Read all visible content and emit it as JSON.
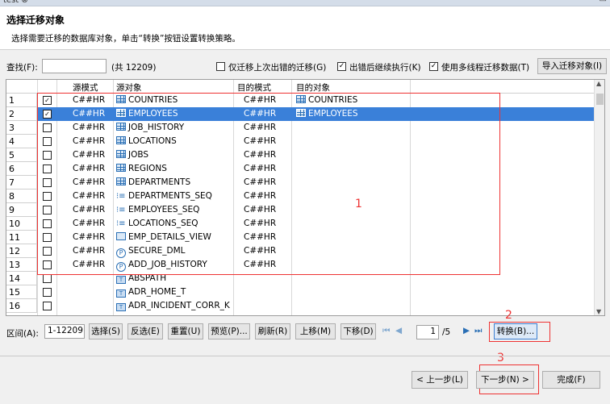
{
  "window": {
    "tab": "test",
    "tab_close": "⊗"
  },
  "header": {
    "title": "选择迁移对象",
    "description": "选择需要迁移的数据库对象，单击“转换”按钮设置转换策略。"
  },
  "find": {
    "label": "查找(F):",
    "value": "",
    "count": "(共 12209)"
  },
  "options": {
    "only_failed": "仅迁移上次出错的迁移(G)",
    "only_failed_checked": false,
    "continue_on_error": "出错后继续执行(K)",
    "continue_on_error_checked": true,
    "multithread": "使用多线程迁移数据(T)",
    "multithread_checked": true,
    "import_button": "导入迁移对象(I)"
  },
  "grid": {
    "headers": {
      "src_schema": "源模式",
      "src_object": "源对象",
      "dst_schema": "目的模式",
      "dst_object": "目的对象"
    },
    "rows": [
      {
        "n": "1",
        "checked": true,
        "src_schema": "C##HR",
        "src_object": "COUNTRIES",
        "icon": "table-icon",
        "dst_schema": "C##HR",
        "dst_object": "COUNTRIES"
      },
      {
        "n": "2",
        "checked": true,
        "src_schema": "C##HR",
        "src_object": "EMPLOYEES",
        "icon": "table-icon",
        "dst_schema": "C##HR",
        "dst_object": "EMPLOYEES",
        "selected": true
      },
      {
        "n": "3",
        "checked": false,
        "src_schema": "C##HR",
        "src_object": "JOB_HISTORY",
        "icon": "table-icon",
        "dst_schema": "C##HR",
        "dst_object": ""
      },
      {
        "n": "4",
        "checked": false,
        "src_schema": "C##HR",
        "src_object": "LOCATIONS",
        "icon": "table-icon",
        "dst_schema": "C##HR",
        "dst_object": ""
      },
      {
        "n": "5",
        "checked": false,
        "src_schema": "C##HR",
        "src_object": "JOBS",
        "icon": "table-icon",
        "dst_schema": "C##HR",
        "dst_object": ""
      },
      {
        "n": "6",
        "checked": false,
        "src_schema": "C##HR",
        "src_object": "REGIONS",
        "icon": "table-icon",
        "dst_schema": "C##HR",
        "dst_object": ""
      },
      {
        "n": "7",
        "checked": false,
        "src_schema": "C##HR",
        "src_object": "DEPARTMENTS",
        "icon": "table-icon",
        "dst_schema": "C##HR",
        "dst_object": ""
      },
      {
        "n": "8",
        "checked": false,
        "src_schema": "C##HR",
        "src_object": "DEPARTMENTS_SEQ",
        "icon": "sequence-icon",
        "dst_schema": "C##HR",
        "dst_object": ""
      },
      {
        "n": "9",
        "checked": false,
        "src_schema": "C##HR",
        "src_object": "EMPLOYEES_SEQ",
        "icon": "sequence-icon",
        "dst_schema": "C##HR",
        "dst_object": ""
      },
      {
        "n": "10",
        "checked": false,
        "src_schema": "C##HR",
        "src_object": "LOCATIONS_SEQ",
        "icon": "sequence-icon",
        "dst_schema": "C##HR",
        "dst_object": ""
      },
      {
        "n": "11",
        "checked": false,
        "src_schema": "C##HR",
        "src_object": "EMP_DETAILS_VIEW",
        "icon": "view-icon",
        "dst_schema": "C##HR",
        "dst_object": ""
      },
      {
        "n": "12",
        "checked": false,
        "src_schema": "C##HR",
        "src_object": "SECURE_DML",
        "icon": "procedure-icon",
        "dst_schema": "C##HR",
        "dst_object": ""
      },
      {
        "n": "13",
        "checked": false,
        "src_schema": "C##HR",
        "src_object": "ADD_JOB_HISTORY",
        "icon": "procedure-icon",
        "dst_schema": "C##HR",
        "dst_object": ""
      },
      {
        "n": "14",
        "checked": false,
        "src_schema": "",
        "src_object": "ABSPATH",
        "icon": "type-icon",
        "dst_schema": "",
        "dst_object": ""
      },
      {
        "n": "15",
        "checked": false,
        "src_schema": "",
        "src_object": "ADR_HOME_T",
        "icon": "type-icon",
        "dst_schema": "",
        "dst_object": ""
      },
      {
        "n": "16",
        "checked": false,
        "src_schema": "",
        "src_object": "ADR_INCIDENT_CORR_K",
        "icon": "type-icon",
        "dst_schema": "",
        "dst_object": ""
      }
    ]
  },
  "toolbar": {
    "range_label": "区间(A):",
    "range_value": "1-12209",
    "select": "选择(S)",
    "invert": "反选(E)",
    "reset": "重置(U)",
    "preview": "预览(P)...",
    "refresh": "刷新(R)",
    "move_up": "上移(M)",
    "move_down": "下移(D)",
    "page_value": "1",
    "page_total": "/5",
    "convert": "转换(B)..."
  },
  "footer": {
    "prev": "< 上一步(L)",
    "next": "下一步(N) >",
    "finish": "完成(F)"
  },
  "annotations": {
    "one": "1",
    "two": "2",
    "three": "3"
  },
  "colors": {
    "selection": "#3a80d9",
    "annotation": "#ee3333",
    "icon": "#2a6fb5"
  }
}
